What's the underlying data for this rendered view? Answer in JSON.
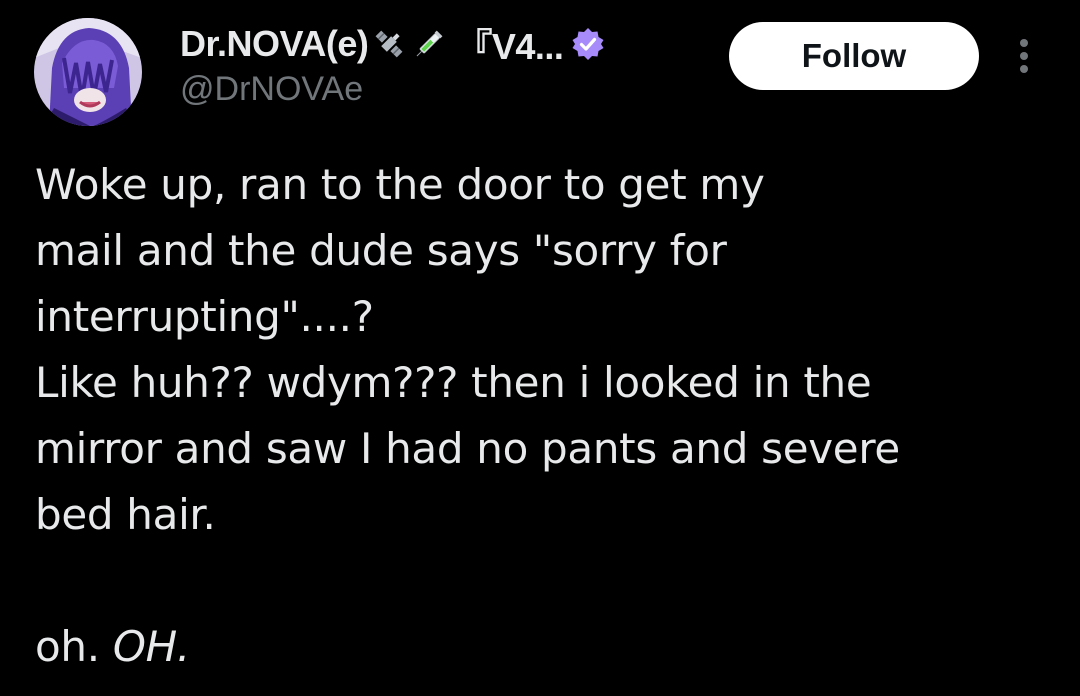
{
  "author": {
    "display_name": "Dr.NOVA(e)",
    "name_emojis": [
      "satellite-emoji",
      "syringe-emoji"
    ],
    "name_suffix": "『V4...",
    "handle": "@DrNOVAe",
    "verified": true,
    "verified_color": "#a78bfa",
    "avatar_description": "purple-haired-character-avatar"
  },
  "actions": {
    "follow_label": "Follow",
    "more_icon": "more-vertical-icon"
  },
  "tweet": {
    "lines": [
      "Woke up, ran to the door to get my",
      "mail and the dude says \"sorry for",
      "interrupting\"....?",
      "Like huh?? wdym??? then i looked in the",
      "mirror and saw I had no pants and severe",
      "bed hair."
    ],
    "last_line_prefix": "oh. ",
    "last_line_emphasis": "OH."
  },
  "colors": {
    "background": "#000000",
    "text_primary": "#e7e9ea",
    "text_secondary": "#71767b",
    "button_bg": "#ffffff",
    "button_text": "#0f1419"
  }
}
